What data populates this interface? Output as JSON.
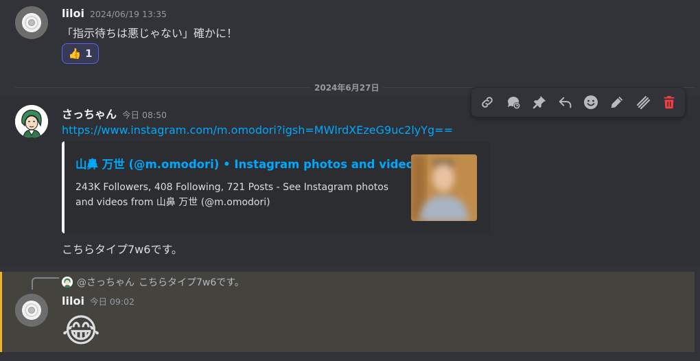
{
  "messages": [
    {
      "username": "liloi",
      "timestamp": "2024/06/19 13:35",
      "content": "「指示待ちは悪じゃない」確かに！",
      "reaction": {
        "emoji": "👍",
        "count": "1"
      }
    },
    {
      "username": "さっちゃん",
      "timestamp": "今日 08:50",
      "link": "https://www.instagram.com/m.omodori?igsh=MWlrdXEzeG9uc2lyYg==",
      "embed": {
        "title": "山鼻 万世 (@m.omodori) • Instagram photos and videos",
        "description": "243K Followers, 408 Following, 721 Posts - See Instagram photos and videos from 山鼻 万世 (@m.omodori)"
      },
      "content": "こちらタイプ7w6です。"
    },
    {
      "reply_to": {
        "mention": "@さっちゃん",
        "preview": "こちらタイプ7w6です。"
      },
      "username": "liloi",
      "timestamp": "今日 09:02",
      "content": "😂"
    }
  ],
  "date_divider": "2024年6月27日",
  "toolbar": {
    "icons": [
      "link-icon",
      "thread-icon",
      "pin-icon",
      "reply-icon",
      "reaction-icon",
      "edit-icon",
      "more-icon",
      "delete-icon"
    ]
  },
  "colors": {
    "background": "#313338",
    "link": "#00a8fc",
    "reaction_border": "#5865f2",
    "reply_highlight": "#f0b232",
    "delete": "#f23f43"
  }
}
